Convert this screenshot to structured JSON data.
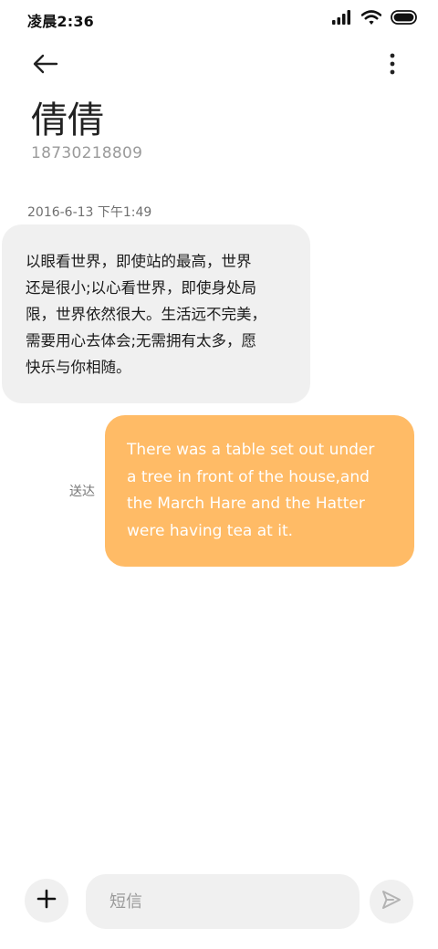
{
  "status_bar": {
    "time": "凌晨2:36",
    "icons": [
      "signal-icon",
      "wifi-icon",
      "battery-icon"
    ]
  },
  "header": {
    "back_icon": "back-arrow-icon",
    "more_icon": "more-vertical-icon",
    "contact_name": "倩倩",
    "contact_number": "18730218809"
  },
  "conversation": {
    "timestamp": "2016-6-13 下午1:49",
    "incoming": {
      "lines": [
        "以眼看世界，即使站的最高，世界",
        "还是很小;以心看世界，即使身处局",
        "限，世界依然很大。生活远不完美，",
        "需要用心去体会;无需拥有太多，愿",
        "快乐与你相随。"
      ]
    },
    "outgoing": {
      "lines": [
        "There was a table set out under",
        "a tree in front of the house,and",
        "the March Hare and the Hatter",
        "were having tea at it."
      ],
      "status": "送达"
    }
  },
  "composer": {
    "add_icon": "plus-icon",
    "placeholder": "短信",
    "value": "",
    "send_icon": "send-icon"
  },
  "colors": {
    "outgoing_bubble": "#ffbb66",
    "incoming_bubble": "#f0f0f0",
    "composer_bg": "#f0f0f0"
  }
}
